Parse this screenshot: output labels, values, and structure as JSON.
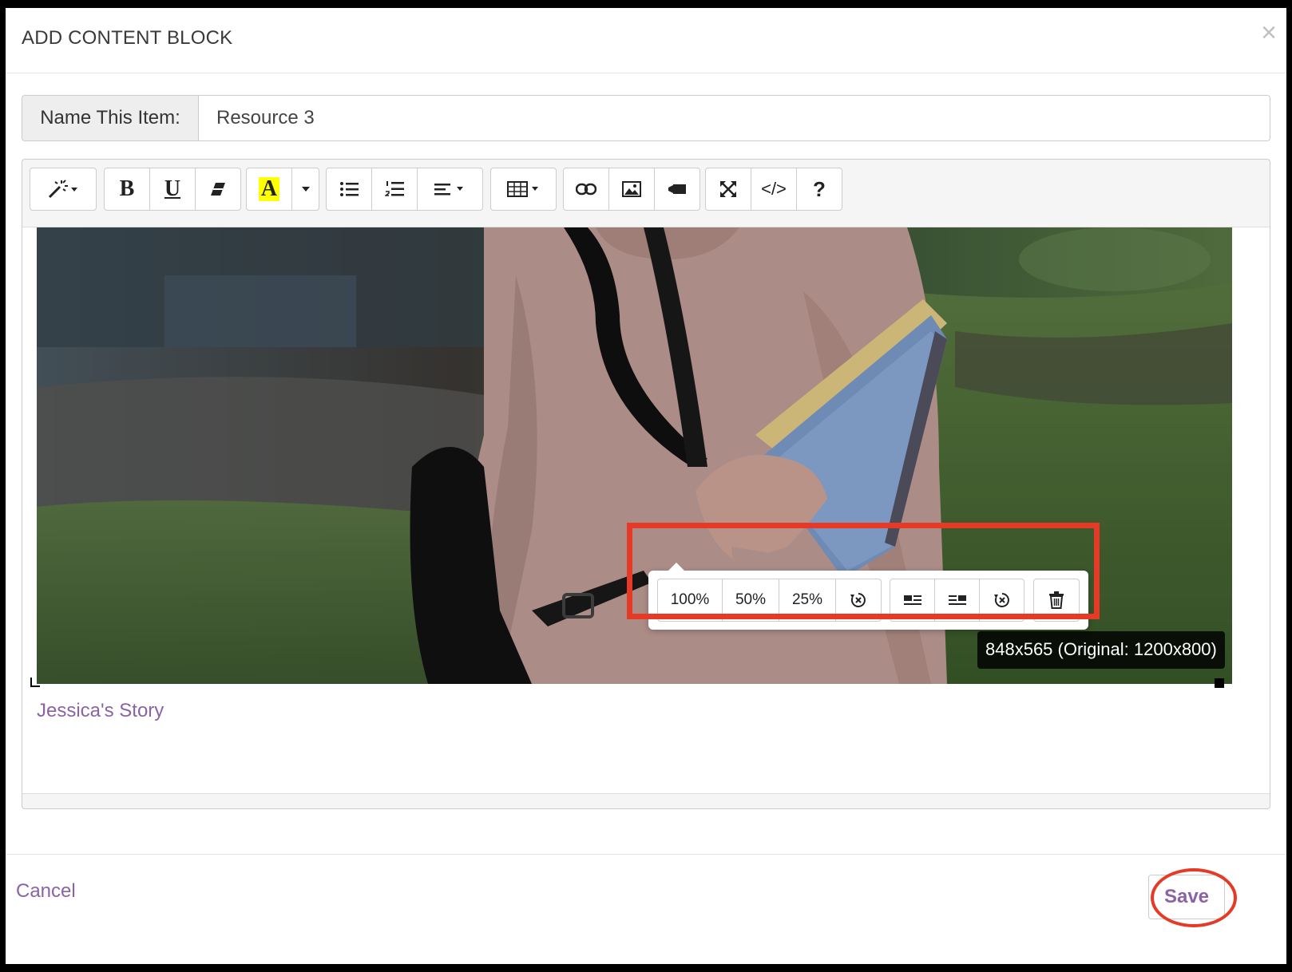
{
  "dialog": {
    "title": "ADD CONTENT BLOCK",
    "close_glyph": "×"
  },
  "name_field": {
    "label": "Name This Item:",
    "value": "Resource 3"
  },
  "toolbar": {
    "groups": [
      [
        "magic-style-icon"
      ],
      [
        "bold-icon",
        "underline-icon",
        "eraser-icon"
      ],
      [
        "text-color-icon",
        "caret-down-icon"
      ],
      [
        "bullet-list-icon",
        "numbered-list-icon",
        "align-icon"
      ],
      [
        "table-icon"
      ],
      [
        "link-icon",
        "image-icon",
        "video-icon"
      ],
      [
        "fullscreen-icon",
        "code-view-icon",
        "help-icon"
      ]
    ],
    "bold_glyph": "B",
    "underline_glyph": "U",
    "text_color_glyph": "A",
    "code_glyph": "</>",
    "help_glyph": "?"
  },
  "image_popover": {
    "size_100": "100%",
    "size_50": "50%",
    "size_25": "25%"
  },
  "image_dimensions": "848x565 (Original: 1200x800)",
  "content": {
    "link_text": "Jessica's Story"
  },
  "footer": {
    "cancel_label": "Cancel",
    "save_label": "Save"
  },
  "colors": {
    "accent": "#8b63a5",
    "highlight": "#e63a26",
    "text_color_bg": "#ffff00"
  }
}
